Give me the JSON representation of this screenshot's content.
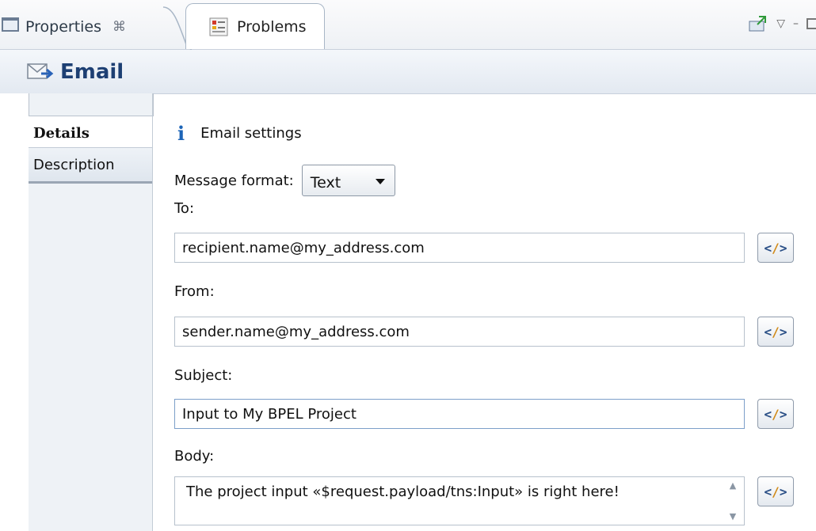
{
  "tabs": {
    "properties_label": "Properties",
    "properties_close": "⌘",
    "problems_label": "Problems"
  },
  "header": {
    "title": "Email"
  },
  "side_tabs": {
    "details": "Details",
    "description": "Description"
  },
  "section": {
    "title": "Email settings"
  },
  "form": {
    "message_format_label": "Message format:",
    "message_format_value": "Text",
    "to_label": "To:",
    "to_value": "recipient.name@my_address.com",
    "from_label": "From:",
    "from_value": "sender.name@my_address.com",
    "subject_label": "Subject:",
    "subject_value": "Input to My BPEL Project",
    "body_label": "Body:",
    "body_value": "The project input «$request.payload/tns:Input» is right here!",
    "expression_button_open": "<",
    "expression_button_slash": "/",
    "expression_button_close": ">"
  },
  "colors": {
    "accent_title": "#1d3f73",
    "info_icon": "#1c64b7"
  }
}
